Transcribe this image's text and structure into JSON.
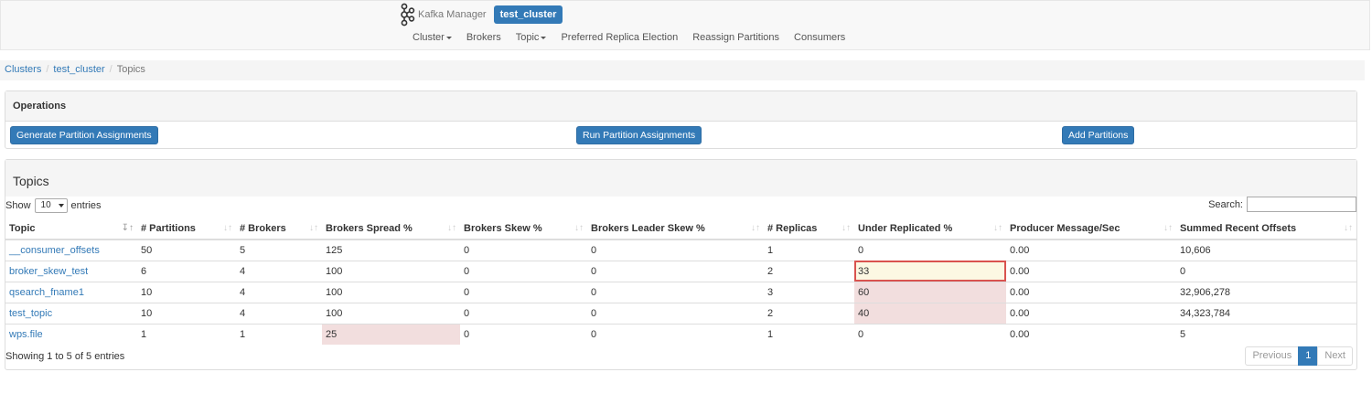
{
  "navbar": {
    "brand": "Kafka Manager",
    "cluster": "test_cluster",
    "items": [
      {
        "label": "Cluster",
        "dropdown": true
      },
      {
        "label": "Brokers",
        "dropdown": false
      },
      {
        "label": "Topic",
        "dropdown": true
      },
      {
        "label": "Preferred Replica Election",
        "dropdown": false
      },
      {
        "label": "Reassign Partitions",
        "dropdown": false
      },
      {
        "label": "Consumers",
        "dropdown": false
      }
    ]
  },
  "breadcrumb": {
    "items": [
      "Clusters",
      "test_cluster"
    ],
    "active": "Topics"
  },
  "operations": {
    "title": "Operations",
    "buttons": [
      "Generate Partition Assignments",
      "Run Partition Assignments",
      "Add Partitions"
    ]
  },
  "topics": {
    "title": "Topics",
    "show_label": "Show",
    "page_size": "10",
    "entries_label": "entries",
    "search_label": "Search:",
    "columns": [
      "Topic",
      "# Partitions",
      "# Brokers",
      "Brokers Spread %",
      "Brokers Skew %",
      "Brokers Leader Skew %",
      "# Replicas",
      "Under Replicated %",
      "Producer Message/Sec",
      "Summed Recent Offsets"
    ],
    "rows": [
      [
        "__consumer_offsets",
        "50",
        "5",
        "125",
        "0",
        "0",
        "1",
        "0",
        "0.00",
        "10,606"
      ],
      [
        "broker_skew_test",
        "6",
        "4",
        "100",
        "0",
        "0",
        "2",
        "33",
        "0.00",
        "0"
      ],
      [
        "qsearch_fname1",
        "10",
        "4",
        "100",
        "0",
        "0",
        "3",
        "60",
        "0.00",
        "32,906,278"
      ],
      [
        "test_topic",
        "10",
        "4",
        "100",
        "0",
        "0",
        "2",
        "40",
        "0.00",
        "34,323,784"
      ],
      [
        "wps.file",
        "1",
        "1",
        "25",
        "0",
        "0",
        "1",
        "0",
        "0.00",
        "5"
      ]
    ],
    "info": "Showing 1 to 5 of 5 entries",
    "pagination": {
      "previous": "Previous",
      "current": "1",
      "next": "Next"
    },
    "colors": {
      "warn": "#f2dede",
      "highlight_border": "#d9534f",
      "link": "#337ab7"
    }
  }
}
